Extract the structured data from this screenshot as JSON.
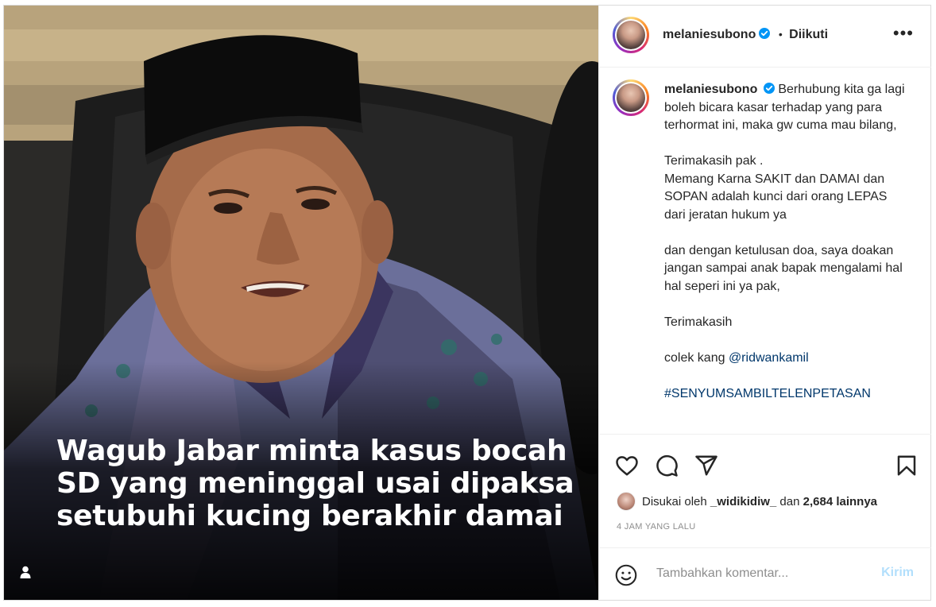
{
  "post": {
    "image": {
      "caption_lines": [
        "Wagub Jabar minta kasus bocah",
        "SD yang meninggal usai dipaksa",
        "setubuhi kucing berakhir damai"
      ],
      "tag_icon": "user-tag-icon"
    },
    "header": {
      "username": "melaniesubono",
      "separator": "•",
      "follow_status": "Diikuti",
      "more_icon": "more-options-icon"
    },
    "caption": {
      "username": "melaniesubono",
      "paragraphs": [
        "Berhubung kita ga lagi boleh bicara kasar terhadap yang para terhormat ini, maka gw cuma mau bilang,",
        "Terimakasih pak .\nMemang Karna SAKIT dan DAMAI dan SOPAN adalah kunci dari orang LEPAS dari jeratan hukum ya",
        "dan dengan ketulusan doa, saya doakan jangan sampai anak bapak mengalami hal hal seperi ini ya pak,",
        "Terimakasih"
      ],
      "mention_prefix": "colek kang ",
      "mention": "@ridwankamil",
      "hashtag": "#SENYUMSAMBILTELENPETASAN"
    },
    "actions": {
      "like_icon": "heart-icon",
      "comment_icon": "comment-icon",
      "share_icon": "share-icon",
      "save_icon": "bookmark-icon"
    },
    "likes": {
      "prefix": "Disukai oleh ",
      "user": "_widikidiw_",
      "middle": " dan ",
      "count": "2,684 lainnya"
    },
    "timestamp": "4 JAM YANG LALU",
    "comment": {
      "placeholder": "Tambahkan komentar...",
      "post_label": "Kirim",
      "emoji_icon": "emoji-icon"
    },
    "colors": {
      "text": "#262626",
      "muted": "#8e8e8e",
      "link": "#00376b",
      "verified": "#0095f6",
      "post_disabled": "#b2dffc"
    }
  }
}
